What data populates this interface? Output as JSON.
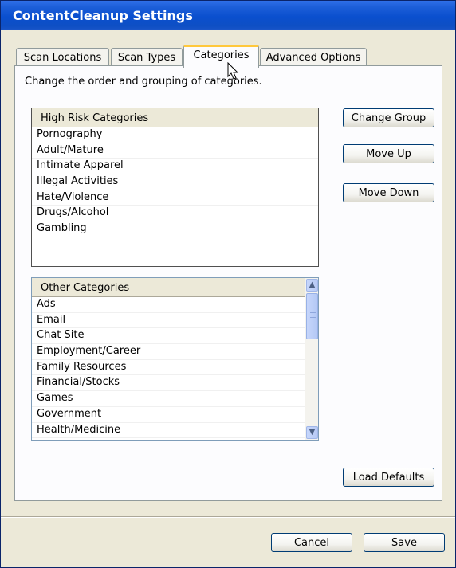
{
  "window": {
    "title": "ContentCleanup Settings"
  },
  "tabs": [
    {
      "label": "Scan Locations"
    },
    {
      "label": "Scan Types"
    },
    {
      "label": "Categories",
      "active": true
    },
    {
      "label": "Advanced Options"
    }
  ],
  "categories_tab": {
    "instruction": "Change the order and grouping of categories.",
    "high_risk": {
      "header": "High Risk Categories",
      "items": [
        "Pornography",
        "Adult/Mature",
        "Intimate Apparel",
        "Illegal Activities",
        "Hate/Violence",
        "Drugs/Alcohol",
        "Gambling"
      ]
    },
    "other": {
      "header": "Other Categories",
      "items": [
        "Ads",
        "Email",
        "Chat Site",
        "Employment/Career",
        "Family Resources",
        "Financial/Stocks",
        "Games",
        "Government",
        "Health/Medicine"
      ]
    },
    "buttons": {
      "change_group": "Change Group",
      "move_up": "Move Up",
      "move_down": "Move Down",
      "load_defaults": "Load Defaults"
    }
  },
  "footer": {
    "cancel": "Cancel",
    "save": "Save"
  },
  "colors": {
    "titlebar": "#0a4fce",
    "active_tab_accent": "#ffc83c",
    "dialog_bg": "#ece9d8"
  },
  "icons": {
    "scroll_up": "chevron-up-icon",
    "scroll_down": "chevron-down-icon",
    "cursor": "mouse-pointer-icon"
  }
}
